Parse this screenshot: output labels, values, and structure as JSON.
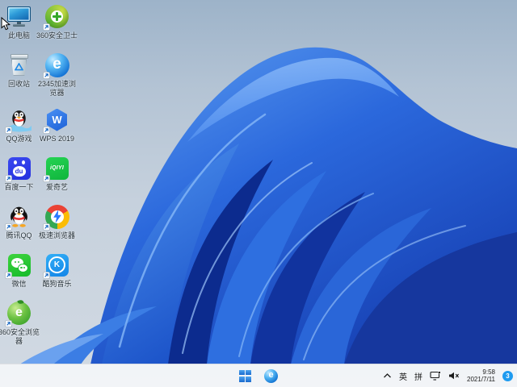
{
  "desktop": {
    "icons": [
      {
        "name": "this-pc",
        "label": "此电脑",
        "shortcut": false
      },
      {
        "name": "360-safety-guard",
        "label": "360安全卫士",
        "shortcut": true
      },
      {
        "name": "recycle-bin",
        "label": "回收站",
        "shortcut": false
      },
      {
        "name": "2345-browser",
        "label": "2345加速浏览器",
        "shortcut": true
      },
      {
        "name": "qq-games",
        "label": "QQ游戏",
        "shortcut": true
      },
      {
        "name": "wps-2019",
        "label": "WPS 2019",
        "shortcut": true
      },
      {
        "name": "baidu-search",
        "label": "百度一下",
        "shortcut": true
      },
      {
        "name": "iqiyi",
        "label": "爱奇艺",
        "shortcut": true
      },
      {
        "name": "tencent-qq",
        "label": "腾讯QQ",
        "shortcut": true
      },
      {
        "name": "speed-browser",
        "label": "极速浏览器",
        "shortcut": true
      },
      {
        "name": "wechat",
        "label": "微信",
        "shortcut": true
      },
      {
        "name": "kugou-music",
        "label": "酷狗音乐",
        "shortcut": true
      },
      {
        "name": "360-browser",
        "label": "360安全浏览器",
        "shortcut": true
      }
    ],
    "glyphs": {
      "wps": "W",
      "iqiyi": "iQIYI",
      "baidu_du": "du",
      "kugou": "K",
      "e_2345": "e",
      "e_360": "e",
      "edge_taskbar": "e"
    }
  },
  "taskbar": {
    "tray": {
      "ime_language": "英",
      "ime_mode": "拼",
      "time": "9:58",
      "date": "2021/7/11",
      "notification_count": "3"
    },
    "icon_names": [
      "chevron-up",
      "ime-language",
      "ime-mode",
      "network-display",
      "volume-muted",
      "clock",
      "notification-badge"
    ]
  },
  "colors": {
    "desktop_bg_top": "#9DB3C9",
    "desktop_bg_bottom": "#D2DAE3",
    "bloom_primary": "#2563D8",
    "bloom_dark": "#0D2E96",
    "bloom_light": "#6CAAF4",
    "taskbar_bg": "#F3F5F8",
    "badge_blue": "#1E9BF0",
    "label_color": "#1D2A33"
  }
}
